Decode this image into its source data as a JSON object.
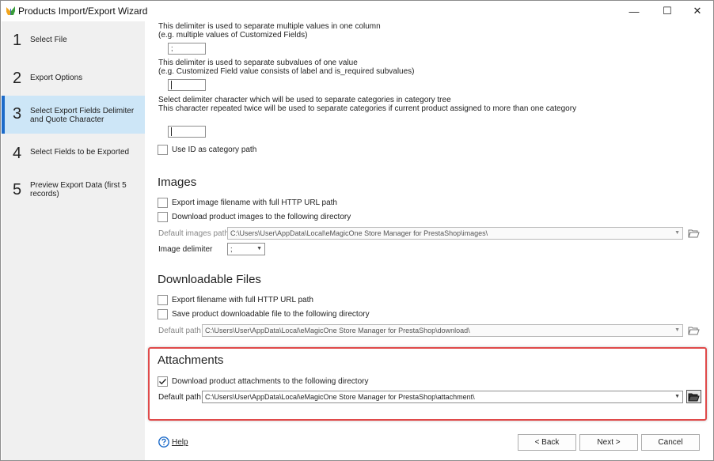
{
  "window": {
    "title": "Products Import/Export Wizard",
    "minimize": "—",
    "maximize": "☐",
    "close": "✕"
  },
  "steps": [
    {
      "num": "1",
      "label": "Select File"
    },
    {
      "num": "2",
      "label": "Export Options"
    },
    {
      "num": "3",
      "label": "Select Export Fields Delimiter and Quote Character"
    },
    {
      "num": "4",
      "label": "Select Fields to be Exported"
    },
    {
      "num": "5",
      "label": "Preview Export Data (first 5 records)"
    }
  ],
  "delimiters": {
    "multi_desc_1": "This delimiter is used to separate multiple values in one column",
    "multi_desc_2": "(e.g. multiple values of Customized Fields)",
    "multi_value": ";",
    "sub_desc_1": "This delimiter is used to separate subvalues of one value",
    "sub_desc_2": "(e.g. Customized Field value consists of label and is_required subvalues)",
    "sub_value": "",
    "cat_desc_1": "Select delimiter character which will be used to separate categories in category tree",
    "cat_desc_2": "This character repeated twice will be used to separate categories if current product assigned to more than one category",
    "cat_value": "",
    "use_id_label": "Use ID as category path",
    "use_id_checked": false
  },
  "images": {
    "title": "Images",
    "export_full_url_label": "Export image filename with full HTTP URL path",
    "export_full_url_checked": false,
    "download_label": "Download product images to the following directory",
    "download_checked": false,
    "path_label": "Default images path",
    "path_value": "C:\\Users\\User\\AppData\\Local\\eMagicOne Store Manager for PrestaShop\\images\\",
    "delimiter_label": "Image delimiter",
    "delimiter_value": ";"
  },
  "downloadable": {
    "title": "Downloadable Files",
    "export_full_url_label": "Export filename with full HTTP URL path",
    "export_full_url_checked": false,
    "save_label": "Save product downloadable file to the following directory",
    "save_checked": false,
    "path_label": "Default path",
    "path_value": "C:\\Users\\User\\AppData\\Local\\eMagicOne Store Manager for PrestaShop\\download\\"
  },
  "attachments": {
    "title": "Attachments",
    "download_label": "Download product attachments to the following directory",
    "download_checked": true,
    "path_label": "Default path",
    "path_value": "C:\\Users\\User\\AppData\\Local\\eMagicOne Store Manager for PrestaShop\\attachment\\"
  },
  "footer": {
    "help": "Help",
    "back": "< Back",
    "next": "Next >",
    "cancel": "Cancel"
  },
  "colors": {
    "active_step_bg": "#cde6f7",
    "active_step_bar": "#1b6ac9",
    "highlight_border": "#e04a4a",
    "help_icon": "#1b6ac9"
  },
  "icons": {
    "app": "app-icon",
    "folder": "folder-open-icon",
    "help": "help-icon",
    "check": "checkmark-icon",
    "dropdown": "chevron-down-icon"
  }
}
